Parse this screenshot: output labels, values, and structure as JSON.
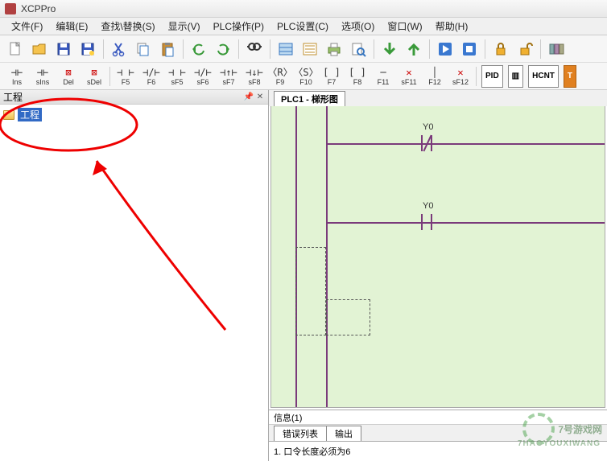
{
  "app": {
    "title": "XCPPro"
  },
  "menu": {
    "file": "文件(F)",
    "edit": "编辑(E)",
    "search": "查找\\替换(S)",
    "view": "显示(V)",
    "plc_op": "PLC操作(P)",
    "plc_set": "PLC设置(C)",
    "option": "选项(O)",
    "window": "窗口(W)",
    "help": "帮助(H)"
  },
  "toolbar2": {
    "items": [
      {
        "sym": "⊣⊢",
        "lbl": "Ins"
      },
      {
        "sym": "⊣⊢",
        "lbl": "sIns"
      },
      {
        "sym": "⊠",
        "lbl": "Del",
        "red": true
      },
      {
        "sym": "⊠",
        "lbl": "sDel",
        "red": true
      },
      {
        "sym": "⊣ ⊢",
        "lbl": "F5"
      },
      {
        "sym": "⊣/⊢",
        "lbl": "F6"
      },
      {
        "sym": "⊣ ⊢",
        "lbl": "sF5"
      },
      {
        "sym": "⊣/⊢",
        "lbl": "sF6"
      },
      {
        "sym": "⊣↑⊢",
        "lbl": "sF7"
      },
      {
        "sym": "⊣↓⊢",
        "lbl": "sF8"
      },
      {
        "sym": "〈R〉",
        "lbl": "F9"
      },
      {
        "sym": "〈S〉",
        "lbl": "F10"
      },
      {
        "sym": "[ ]",
        "lbl": "F7"
      },
      {
        "sym": "[ ]",
        "lbl": "F8"
      },
      {
        "sym": "─",
        "lbl": "F11"
      },
      {
        "sym": "✕",
        "lbl": "sF11",
        "red": true
      },
      {
        "sym": "│",
        "lbl": "F12"
      },
      {
        "sym": "✕",
        "lbl": "sF12",
        "red": true
      }
    ],
    "specials": [
      {
        "label": "PID"
      },
      {
        "label": "▥"
      },
      {
        "label": "HCNT"
      },
      {
        "label": "T",
        "orange": true
      }
    ]
  },
  "left_panel": {
    "title": "工程",
    "tree_root": "工程"
  },
  "right_panel": {
    "tab_label": "PLC1 - 梯形图",
    "rungs": [
      {
        "label": "Y0"
      },
      {
        "label": "Y0"
      }
    ]
  },
  "info_panel": {
    "header": "信息(1)",
    "tabs": {
      "errors": "错误列表",
      "output": "输出"
    },
    "message": "1. 口令长度必须为6"
  },
  "watermark": {
    "main": "7号游戏网",
    "sub": "7HAOYOUXIWANG"
  }
}
